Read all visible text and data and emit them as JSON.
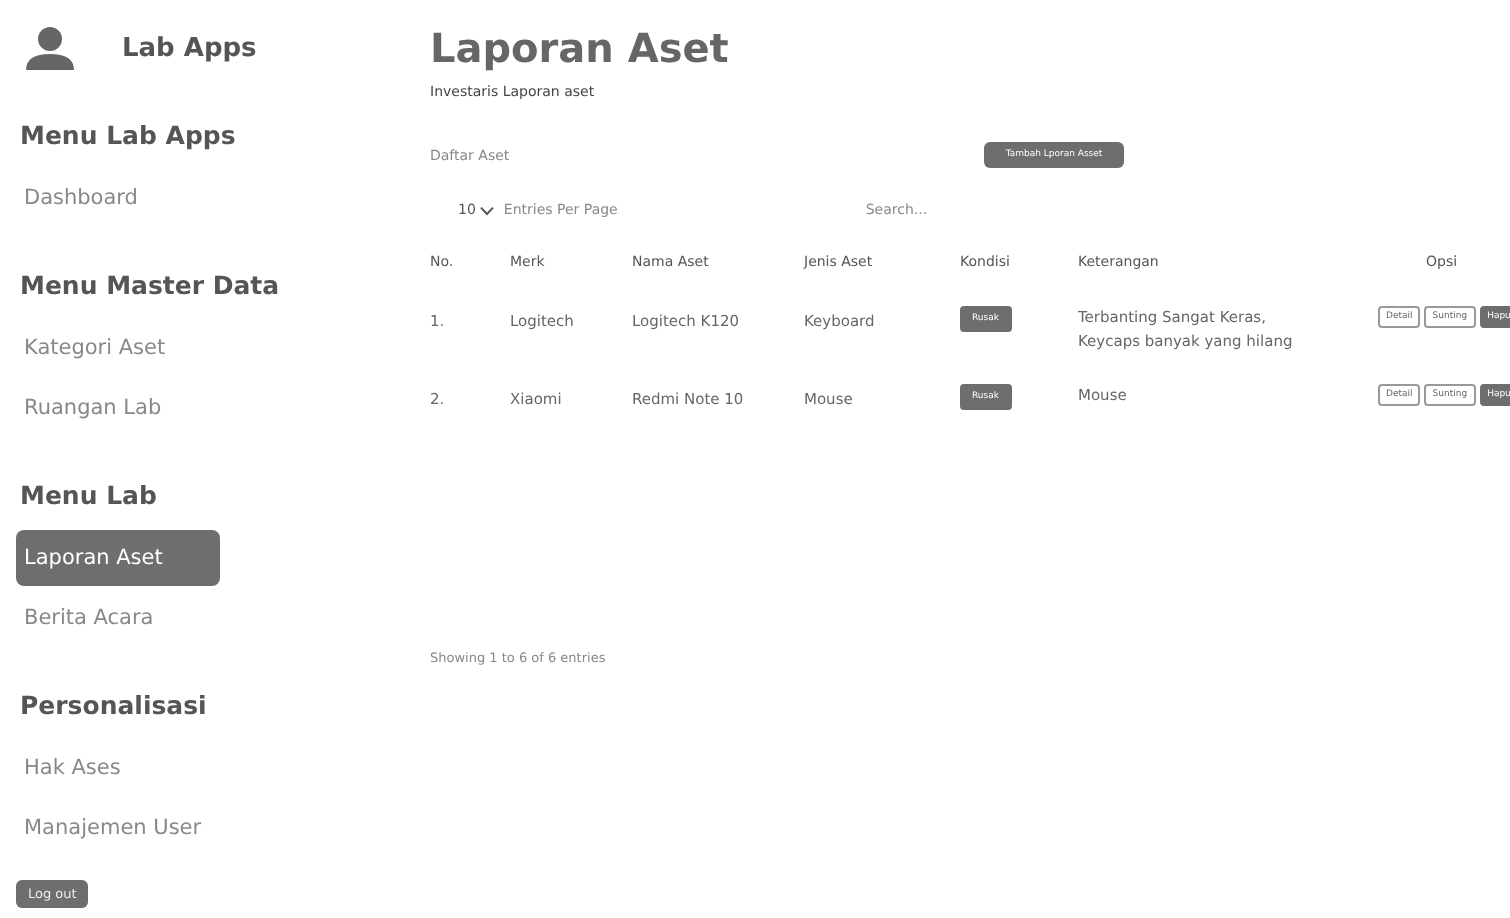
{
  "brand": {
    "title": "Lab Apps"
  },
  "sidebar": {
    "sections": [
      {
        "heading": "Menu Lab Apps",
        "items": [
          {
            "label": "Dashboard",
            "selected": false
          }
        ]
      },
      {
        "heading": "Menu Master Data",
        "items": [
          {
            "label": "Kategori Aset",
            "selected": false
          },
          {
            "label": "Ruangan Lab",
            "selected": false
          }
        ]
      },
      {
        "heading": "Menu Lab",
        "items": [
          {
            "label": "Laporan Aset",
            "selected": true
          },
          {
            "label": "Berita Acara",
            "selected": false
          }
        ]
      },
      {
        "heading": "Personalisasi",
        "items": [
          {
            "label": "Hak Ases",
            "selected": false
          },
          {
            "label": "Manajemen User",
            "selected": false
          }
        ]
      }
    ],
    "logout": "Log out"
  },
  "page": {
    "title": "Laporan Aset",
    "subtitle": "Investaris Laporan aset",
    "list_title": "Daftar Aset",
    "add_button": "Tambah Lporan Asset"
  },
  "table_controls": {
    "page_size": "10",
    "page_size_label": "Entries Per Page",
    "search_placeholder": "Search..."
  },
  "table": {
    "columns": [
      "No.",
      "Merk",
      "Nama Aset",
      "Jenis Aset",
      "Kondisi",
      "Keterangan",
      "Opsi"
    ],
    "rows": [
      {
        "no": "1.",
        "merk": "Logitech",
        "nama": "Logitech K120",
        "jenis": "Keyboard",
        "kondisi": "Rusak",
        "keterangan": "Terbanting Sangat Keras, Keycaps banyak yang hilang",
        "actions": [
          "Detail",
          "Sunting",
          "Hapu"
        ]
      },
      {
        "no": "2.",
        "merk": "Xiaomi",
        "nama": "Redmi Note 10",
        "jenis": "Mouse",
        "kondisi": "Rusak",
        "keterangan": "Mouse",
        "actions": [
          "Detail",
          "Sunting",
          "Hapu"
        ]
      }
    ]
  },
  "footer": {
    "info": "Showing 1 to 6 of 6 entries"
  }
}
